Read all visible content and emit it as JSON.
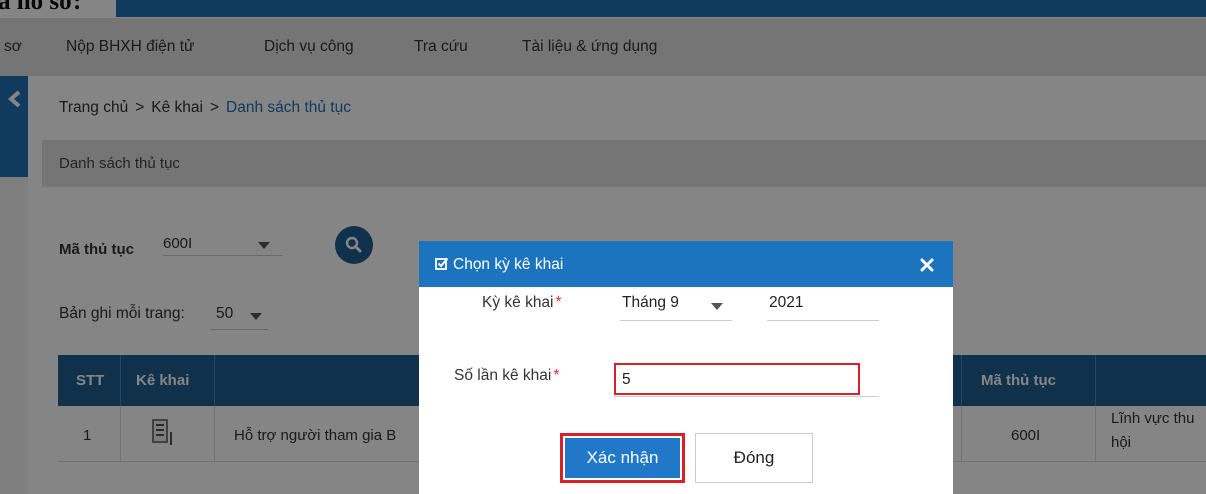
{
  "top_fragment": "a hồ sơ:",
  "nav": {
    "items": [
      "sơ",
      "Nộp BHXH điện tử",
      "Dịch vụ công",
      "Tra cứu",
      "Tài liệu & ứng dụng"
    ]
  },
  "breadcrumb": {
    "home": "Trang chủ",
    "separator": ">",
    "level1": "Kê khai",
    "current": "Danh sách thủ tục"
  },
  "panel": {
    "title": "Danh sách thủ tục"
  },
  "filter": {
    "label": "Mã thủ tục",
    "value": "600I"
  },
  "pagesize": {
    "label": "Bản ghi mỗi trang:",
    "value": "50"
  },
  "table": {
    "headers": [
      "STT",
      "Kê khai",
      "Mã thủ tục"
    ],
    "rows": [
      {
        "stt": "1",
        "name": "Hỗ trợ người tham gia B",
        "code": "600I",
        "field_line1": "Lĩnh vực thu",
        "field_line2": "hội"
      }
    ]
  },
  "modal": {
    "title": "Chọn kỳ kê khai",
    "period_label": "Kỳ kê khai",
    "month_value": "Tháng 9",
    "year_value": "2021",
    "count_label": "Số lần kê khai",
    "count_value": "5",
    "required_mark": "*",
    "confirm_label": "Xác nhận",
    "close_label": "Đóng"
  },
  "colors": {
    "brand_blue": "#1f6fb4",
    "header_blue": "#1e5f92",
    "modal_header": "#1d74be",
    "button_blue": "#2178c8",
    "highlight_red": "#d9202a"
  }
}
